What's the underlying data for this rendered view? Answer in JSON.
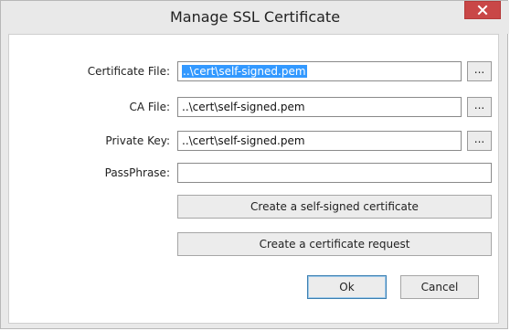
{
  "window": {
    "title": "Manage SSL Certificate"
  },
  "form": {
    "certificate_file": {
      "label": "Certificate File:",
      "value": "..\\cert\\self-signed.pem",
      "browse_label": "..."
    },
    "ca_file": {
      "label": "CA File:",
      "value": "..\\cert\\self-signed.pem",
      "browse_label": "..."
    },
    "private_key": {
      "label": "Private Key:",
      "value": "..\\cert\\self-signed.pem",
      "browse_label": "..."
    },
    "passphrase": {
      "label": "PassPhrase:",
      "value": ""
    }
  },
  "actions": {
    "create_self_signed": "Create a self-signed certificate",
    "create_request": "Create a certificate request",
    "ok": "Ok",
    "cancel": "Cancel"
  },
  "colors": {
    "close_button": "#c94747",
    "selection": "#3399ff",
    "default_button_border": "#3c7fb1"
  },
  "icons": {
    "close": "close-icon"
  }
}
